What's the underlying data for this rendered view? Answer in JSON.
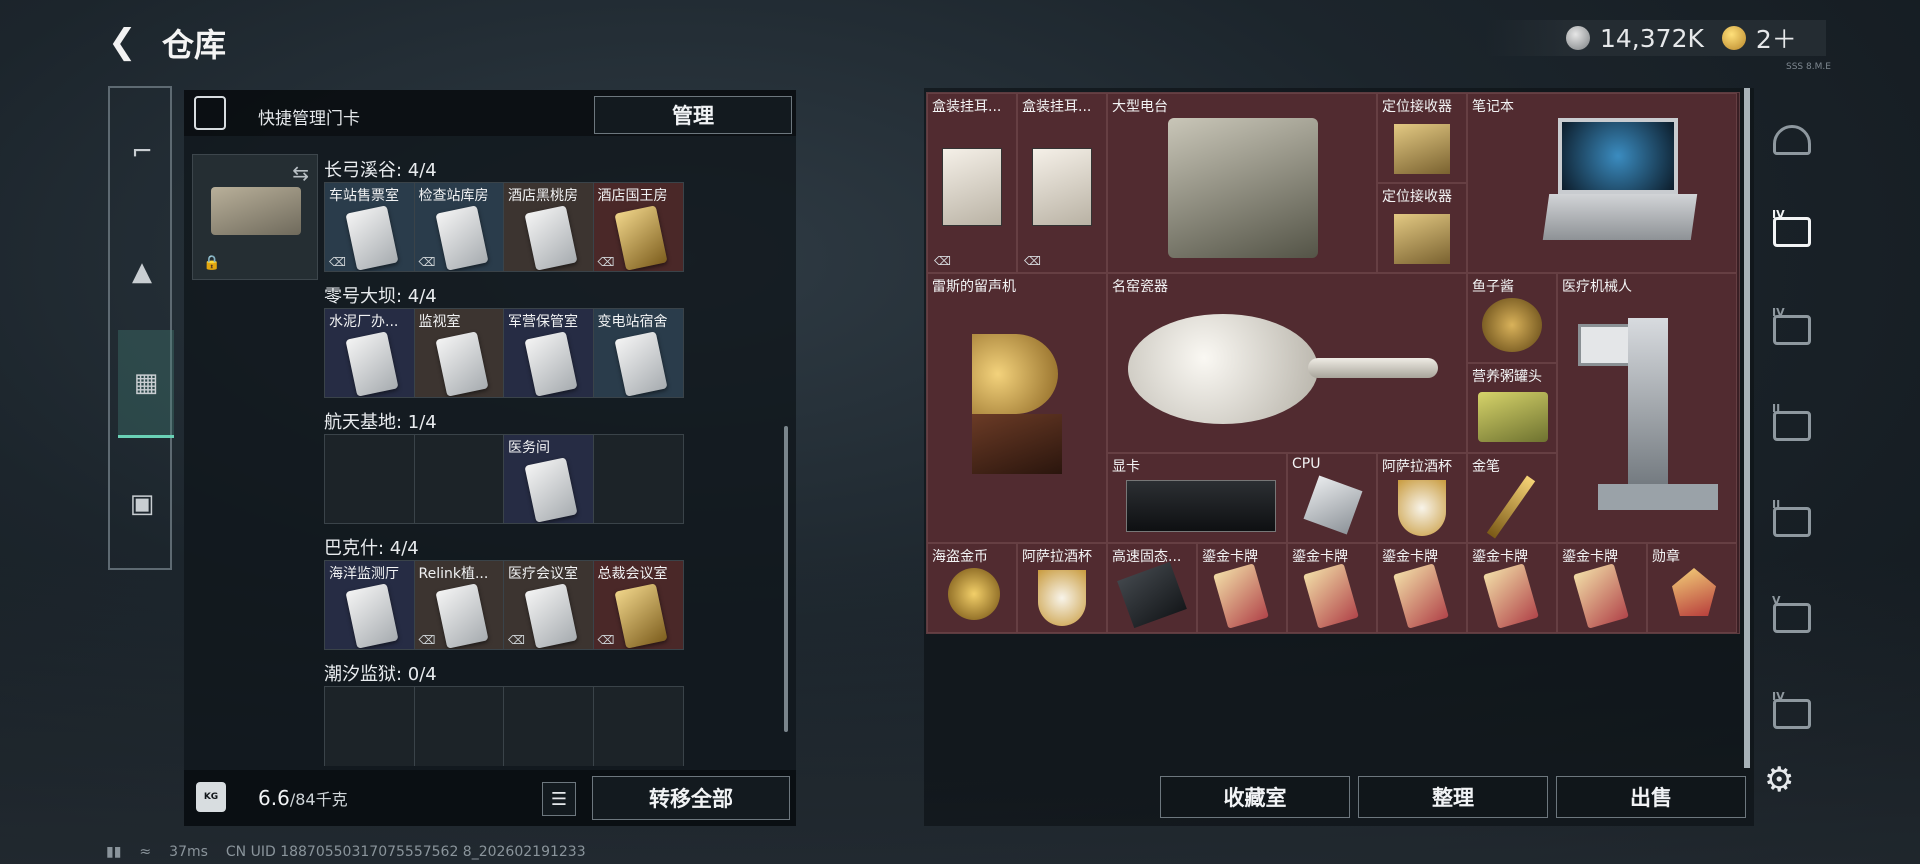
{
  "header": {
    "back_icon": "back-arrow-icon",
    "title": "仓库",
    "currency_silver": "14,372K",
    "currency_gold": "2＋",
    "tiny_text": "SSS 8.M.E"
  },
  "left_categories": [
    {
      "name": "pistol",
      "icon": "pistol-icon"
    },
    {
      "name": "armor",
      "icon": "backpack-icon"
    },
    {
      "name": "keycard",
      "icon": "keycard-icon"
    },
    {
      "name": "toolbox",
      "icon": "toolbox-icon"
    }
  ],
  "keycard_panel": {
    "title": "快捷管理门卡",
    "manage_label": "管理",
    "groups": [
      {
        "title": "长弓溪谷: 4/4",
        "slots": [
          {
            "label": "车站售票室",
            "type": "blue"
          },
          {
            "label": "检查站库房",
            "type": "blue"
          },
          {
            "label": "酒店黑桃房",
            "type": "brown"
          },
          {
            "label": "酒店国王房",
            "type": "red"
          }
        ]
      },
      {
        "title": "零号大坝: 4/4",
        "slots": [
          {
            "label": "水泥厂办...",
            "type": "navy"
          },
          {
            "label": "监视室",
            "type": "brown"
          },
          {
            "label": "军营保管室",
            "type": "navy"
          },
          {
            "label": "变电站宿舍",
            "type": "blue"
          }
        ]
      },
      {
        "title": "航天基地: 1/4",
        "slots": [
          {
            "label": "",
            "type": "empty"
          },
          {
            "label": "",
            "type": "empty"
          },
          {
            "label": "医务间",
            "type": "navy"
          },
          {
            "label": "",
            "type": "empty"
          }
        ]
      },
      {
        "title": "巴克什: 4/4",
        "slots": [
          {
            "label": "海洋监测厅",
            "type": "navy"
          },
          {
            "label": "Relink植...",
            "type": "brown"
          },
          {
            "label": "医疗会议室",
            "type": "brown"
          },
          {
            "label": "总裁会议室",
            "type": "red"
          }
        ]
      },
      {
        "title": "潮汐监狱: 0/4",
        "slots": []
      }
    ],
    "weight_value": "6.6",
    "weight_unit": "/84千克",
    "weight_icon_text": "KG",
    "transfer_label": "转移全部"
  },
  "stash": {
    "items": [
      {
        "label": "盒装挂耳...",
        "kind": "coffee"
      },
      {
        "label": "盒装挂耳...",
        "kind": "coffee"
      },
      {
        "label": "大型电台",
        "kind": "radio"
      },
      {
        "label": "定位接收器",
        "kind": "receiver"
      },
      {
        "label": "定位接收器",
        "kind": "receiver"
      },
      {
        "label": "笔记本",
        "kind": "laptop"
      },
      {
        "label": "雷斯的留声机",
        "kind": "gramophone"
      },
      {
        "label": "名窑瓷器",
        "kind": "vase"
      },
      {
        "label": "鱼子酱",
        "kind": "caviar"
      },
      {
        "label": "营养粥罐头",
        "kind": "can"
      },
      {
        "label": "医疗机械人",
        "kind": "robot"
      },
      {
        "label": "显卡",
        "kind": "gpu"
      },
      {
        "label": "CPU",
        "kind": "cpu"
      },
      {
        "label": "阿萨拉酒杯",
        "kind": "cup"
      },
      {
        "label": "金笔",
        "kind": "pen"
      },
      {
        "label": "海盗金币",
        "kind": "coin"
      },
      {
        "label": "阿萨拉酒杯",
        "kind": "cup"
      },
      {
        "label": "高速固态...",
        "kind": "ssd"
      },
      {
        "label": "鎏金卡牌",
        "kind": "card"
      },
      {
        "label": "鎏金卡牌",
        "kind": "card"
      },
      {
        "label": "鎏金卡牌",
        "kind": "card"
      },
      {
        "label": "鎏金卡牌",
        "kind": "card"
      },
      {
        "label": "鎏金卡牌",
        "kind": "card"
      },
      {
        "label": "勋章",
        "kind": "medal"
      }
    ],
    "buttons": {
      "collection": "收藏室",
      "sort": "整理",
      "sell": "出售"
    }
  },
  "right_rail": [
    {
      "tag": "",
      "icon": "helmet-icon"
    },
    {
      "tag": "IV",
      "icon": "case-icon"
    },
    {
      "tag": "IV",
      "icon": "case-add-icon"
    },
    {
      "tag": "II",
      "icon": "case-add-icon"
    },
    {
      "tag": "II",
      "icon": "folder-icon"
    },
    {
      "tag": "V",
      "icon": "case-icon"
    },
    {
      "tag": "IV",
      "icon": "case-icon"
    }
  ],
  "status_bar": {
    "ping": "37ms",
    "uid": "CN UID 18870550317075557562 8_202602191233"
  },
  "colors": {
    "accent_teal": "#6ad1b6",
    "stash_cell": "#512b30",
    "card_blue": "#2a3c4b",
    "card_red": "#4a2828"
  }
}
